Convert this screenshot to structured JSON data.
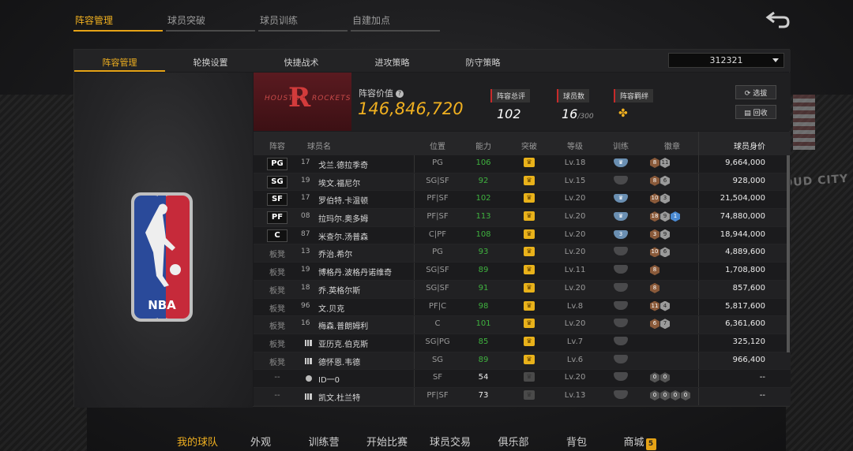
{
  "top_tabs": [
    "阵容管理",
    "球员突破",
    "球员训练",
    "自建加点"
  ],
  "sub_tabs": [
    "阵容管理",
    "轮换设置",
    "快捷战术",
    "进攻策略",
    "防守策略"
  ],
  "team_select": "312321",
  "banner": {
    "value_label": "阵容价值",
    "value": "146,846,720",
    "rating_label": "阵容总评",
    "rating": "102",
    "players_label": "球员数",
    "players": "16",
    "players_max": "/300",
    "bond_label": "阵容羁绊",
    "select_btn": "选拔",
    "recycle_btn": "回收"
  },
  "headers": [
    "阵容",
    "球员名",
    "位置",
    "能力",
    "突破",
    "等级",
    "训练",
    "徽章",
    "球员身价"
  ],
  "rows": [
    {
      "pos": "PG",
      "num": "17",
      "name": "戈兰.德拉季奇",
      "posv": "PG",
      "rating": "106",
      "level": "Lv.18",
      "value": "9,664,000",
      "starter": true,
      "break": true,
      "train": true,
      "badges": [
        [
          "bronze",
          "8"
        ],
        [
          "silver",
          "11"
        ]
      ]
    },
    {
      "pos": "SG",
      "num": "19",
      "name": "埃文.福尼尔",
      "posv": "SG|SF",
      "rating": "92",
      "level": "Lv.15",
      "value": "928,000",
      "starter": true,
      "break": true,
      "train": false,
      "badges": [
        [
          "bronze",
          "8"
        ],
        [
          "silver",
          "6"
        ]
      ]
    },
    {
      "pos": "SF",
      "num": "17",
      "name": "罗伯特.卡温顿",
      "posv": "PF|SF",
      "rating": "102",
      "level": "Lv.20",
      "value": "21,504,000",
      "starter": true,
      "break": true,
      "train": true,
      "badges": [
        [
          "bronze",
          "10"
        ],
        [
          "silver",
          "3"
        ]
      ]
    },
    {
      "pos": "PF",
      "num": "08",
      "name": "拉玛尔.奥多姆",
      "posv": "PF|SF",
      "rating": "113",
      "level": "Lv.20",
      "value": "74,880,000",
      "starter": true,
      "break": true,
      "train": true,
      "badges": [
        [
          "bronze",
          "18"
        ],
        [
          "silver",
          "9"
        ],
        [
          "blue",
          "1"
        ]
      ]
    },
    {
      "pos": "C",
      "num": "87",
      "name": "米查尔.汤普森",
      "posv": "C|PF",
      "rating": "108",
      "level": "Lv.20",
      "value": "18,944,000",
      "starter": true,
      "break": true,
      "train": true,
      "train_num": "3",
      "badges": [
        [
          "bronze",
          "3"
        ],
        [
          "silver",
          "9"
        ]
      ]
    },
    {
      "pos": "板凳",
      "num": "13",
      "name": "乔治.希尔",
      "posv": "PG",
      "rating": "93",
      "level": "Lv.20",
      "value": "4,889,600",
      "starter": false,
      "break": true,
      "train": false,
      "badges": [
        [
          "bronze",
          "10"
        ],
        [
          "silver",
          "6"
        ]
      ]
    },
    {
      "pos": "板凳",
      "num": "19",
      "name": "博格丹.波格丹诺维奇",
      "posv": "SG|SF",
      "rating": "89",
      "level": "Lv.11",
      "value": "1,708,800",
      "starter": false,
      "break": true,
      "train": false,
      "badges": [
        [
          "bronze",
          "8"
        ]
      ]
    },
    {
      "pos": "板凳",
      "num": "18",
      "name": "乔.英格尔斯",
      "posv": "SG|SF",
      "rating": "91",
      "level": "Lv.20",
      "value": "857,600",
      "starter": false,
      "break": true,
      "train": false,
      "badges": [
        [
          "bronze",
          "8"
        ]
      ]
    },
    {
      "pos": "板凳",
      "num": "96",
      "name": "文.贝克",
      "posv": "PF|C",
      "rating": "98",
      "level": "Lv.8",
      "value": "5,817,600",
      "starter": false,
      "break": true,
      "train": false,
      "badges": [
        [
          "bronze",
          "11"
        ],
        [
          "silver",
          "4"
        ]
      ]
    },
    {
      "pos": "板凳",
      "num": "16",
      "name": "梅森.普朗姆利",
      "posv": "C",
      "rating": "101",
      "level": "Lv.20",
      "value": "6,361,600",
      "starter": false,
      "break": true,
      "train": false,
      "badges": [
        [
          "bronze",
          "6"
        ],
        [
          "silver",
          "7"
        ]
      ]
    },
    {
      "pos": "板凳",
      "num": "",
      "name": "亚历克.伯克斯",
      "posv": "SG|PG",
      "rating": "85",
      "level": "Lv.7",
      "value": "325,120",
      "starter": false,
      "break": true,
      "train": false,
      "badges": []
    },
    {
      "pos": "板凳",
      "num": "",
      "name": "德怀恩.韦德",
      "posv": "SG",
      "rating": "89",
      "level": "Lv.6",
      "value": "966,400",
      "starter": false,
      "break": true,
      "train": false,
      "badges": []
    },
    {
      "pos": "--",
      "num": "",
      "name": "ID一0",
      "posv": "SF",
      "rating": "54",
      "level": "Lv.20",
      "value": "--",
      "starter": false,
      "break": false,
      "train": false,
      "badges": [
        [
          "gray",
          "0"
        ],
        [
          "gray",
          "0"
        ]
      ],
      "person": true
    },
    {
      "pos": "--",
      "num": "",
      "name": "凯文.杜兰特",
      "posv": "PF|SF",
      "rating": "73",
      "level": "Lv.13",
      "value": "--",
      "starter": false,
      "break": false,
      "train": false,
      "badges": [
        [
          "gray",
          "0"
        ],
        [
          "gray",
          "0"
        ],
        [
          "gray",
          "0"
        ],
        [
          "gray",
          "0"
        ]
      ]
    }
  ],
  "bottom_nav": [
    "我的球队",
    "外观",
    "训练营",
    "开始比赛",
    "球员交易",
    "俱乐部",
    "背包",
    "商城"
  ],
  "bottom_nav_badge": "5",
  "colors": {
    "accent": "#e6a316",
    "rockets_red": "#c82a2a",
    "rating_green": "#3fb23f"
  }
}
